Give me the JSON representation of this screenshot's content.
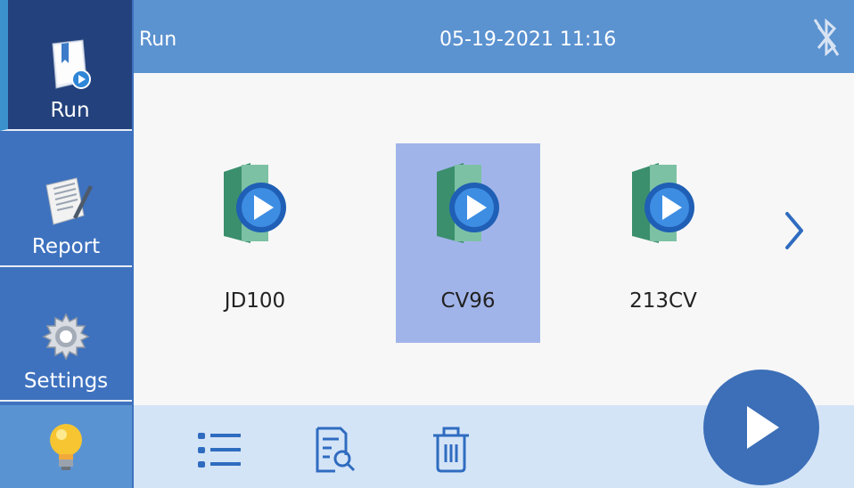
{
  "sidebar": {
    "items": [
      {
        "label": "Run",
        "icon": "run-doc-icon",
        "active": true
      },
      {
        "label": "Report",
        "icon": "report-doc-icon",
        "active": false
      },
      {
        "label": "Settings",
        "icon": "gear-icon",
        "active": false
      }
    ],
    "bottom_icon": "lightbulb-icon"
  },
  "header": {
    "title": "Run",
    "datetime": "05-19-2021 11:16",
    "status_icon": "bluetooth-off-icon"
  },
  "programs": [
    {
      "name": "JD100",
      "selected": false
    },
    {
      "name": "CV96",
      "selected": true
    },
    {
      "name": "213CV",
      "selected": false
    }
  ],
  "toolbar": {
    "icons": [
      "list-icon",
      "search-document-icon",
      "trash-icon"
    ]
  },
  "actions": {
    "next_icon": "chevron-right-icon",
    "run_icon": "play-icon"
  },
  "colors": {
    "sidebar": "#3e72bf",
    "sidebar_active": "#23417c",
    "header": "#5b92d0",
    "selected": "#a1b4ea",
    "toolbar": "#d4e4f7",
    "run_button": "#3c6fb8"
  }
}
